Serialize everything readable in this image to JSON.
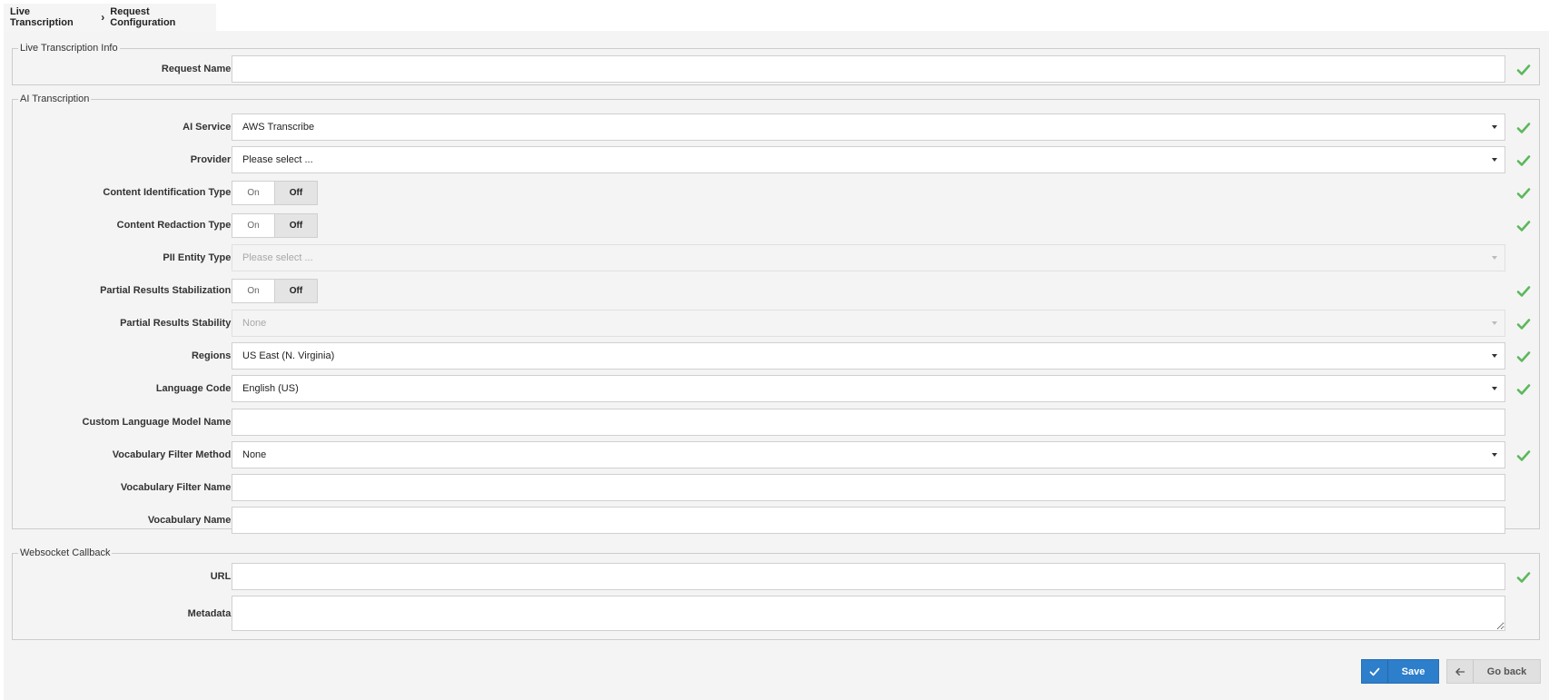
{
  "breadcrumb": {
    "root": "Live Transcription",
    "current": "Request Configuration"
  },
  "groups": {
    "info": "Live Transcription Info",
    "ai": "AI Transcription",
    "ws": "Websocket Callback"
  },
  "fields": {
    "request_name": {
      "label": "Request Name:",
      "value": ""
    },
    "ai_service": {
      "label": "AI Service:",
      "value": "AWS Transcribe"
    },
    "provider": {
      "label": "Provider:",
      "value": "Please select ..."
    },
    "content_identification": {
      "label": "Content Identification Type:",
      "on": "On",
      "off": "Off"
    },
    "content_redaction": {
      "label": "Content Redaction Type:",
      "on": "On",
      "off": "Off"
    },
    "pii_entity": {
      "label": "PII Entity Type:",
      "value": "Please select ..."
    },
    "partial_stabilization": {
      "label": "Partial Results Stabilization:",
      "on": "On",
      "off": "Off"
    },
    "partial_stability": {
      "label": "Partial Results Stability:",
      "value": "None"
    },
    "regions": {
      "label": "Regions:",
      "value": "US East (N. Virginia)"
    },
    "language_code": {
      "label": "Language Code:",
      "value": "English (US)"
    },
    "custom_model": {
      "label": "Custom Language Model Name:",
      "value": ""
    },
    "vocab_filter_method": {
      "label": "Vocabulary Filter Method:",
      "value": "None"
    },
    "vocab_filter_name": {
      "label": "Vocabulary Filter Name:",
      "value": ""
    },
    "vocab_name": {
      "label": "Vocabulary Name:",
      "value": ""
    },
    "url": {
      "label": "URL:",
      "value": ""
    },
    "metadata": {
      "label": "Metadata:",
      "value": ""
    }
  },
  "buttons": {
    "save": "Save",
    "back": "Go back"
  },
  "colors": {
    "accent": "#2d7ecb",
    "check": "#5cb85c"
  }
}
